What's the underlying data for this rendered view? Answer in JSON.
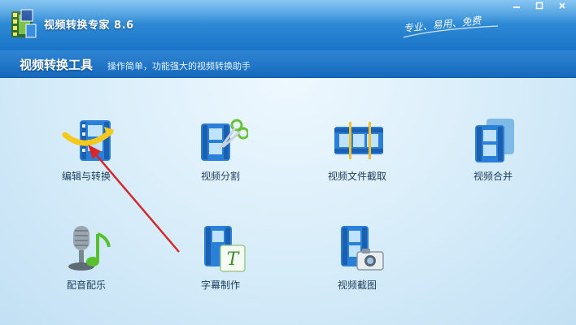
{
  "window": {
    "title": "视频转换专家 8.6",
    "slogan": "专业、易用、免费"
  },
  "toolbar": {
    "title": "视频转换工具",
    "description": "操作简单，功能强大的视频转换助手"
  },
  "tools": [
    {
      "label": "编辑与转换",
      "icon": "film-convert-icon"
    },
    {
      "label": "视频分割",
      "icon": "film-scissors-icon"
    },
    {
      "label": "视频文件截取",
      "icon": "film-clip-icon"
    },
    {
      "label": "视频合并",
      "icon": "film-merge-icon"
    },
    {
      "label": "配音配乐",
      "icon": "microphone-music-icon"
    },
    {
      "label": "字幕制作",
      "icon": "film-subtitle-icon"
    },
    {
      "label": "视频截图",
      "icon": "film-camera-icon"
    }
  ],
  "colors": {
    "titlebar": "#2f8bd6",
    "toolbar": "#1669bd",
    "background": "#d6ecf9",
    "annotation_arrow": "#d9262b"
  }
}
